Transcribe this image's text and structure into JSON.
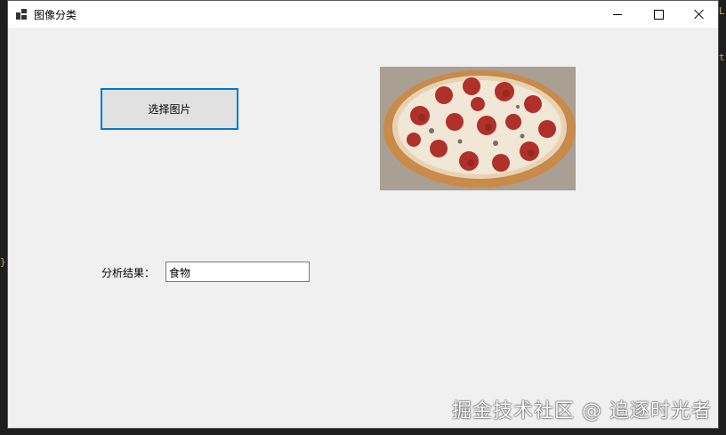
{
  "window": {
    "title": "图像分类",
    "icon": "app-window-icon",
    "caption_buttons": [
      "minimize-icon",
      "maximize-icon",
      "close-icon"
    ]
  },
  "main": {
    "select_button_label": "选择图片",
    "image": {
      "description_icon": "pizza-image"
    },
    "result_label": "分析结果：",
    "result_value": "食物"
  },
  "watermark": "掘金技术社区 @ 追逐时光者",
  "colors": {
    "focus_border": "#0078d7",
    "window_bg": "#f0f0f0",
    "button_bg": "#e1e1e1"
  }
}
